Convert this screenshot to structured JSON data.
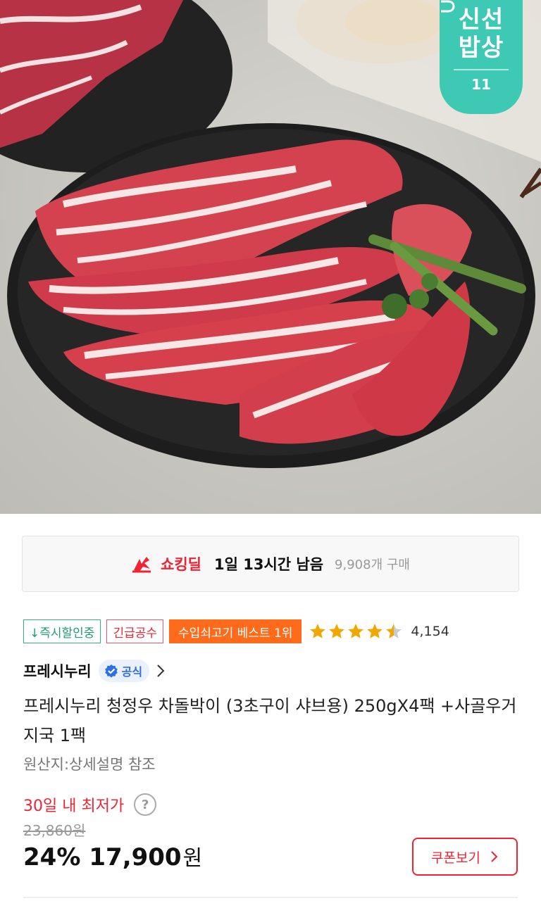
{
  "hero": {
    "badge_line1": "신선",
    "badge_line2": "밥상",
    "badge_logo": "11"
  },
  "deal": {
    "name": "쇼킹딜",
    "time_left": "1일 13시간 남음",
    "purchases": "9,908개 구매",
    "icon": "shocking-deal-flag-icon"
  },
  "tags": [
    "↓즉시할인중",
    "긴급공수",
    "수입쇠고기 베스트 1위"
  ],
  "rating": {
    "stars": 4.5,
    "count": "4,154"
  },
  "seller": {
    "name": "프레시누리",
    "official": "공식"
  },
  "product": {
    "title": "프레시누리 청정우 차돌박이 (3초구이 샤브용) 250gX4팩 +사골우거지국 1팩",
    "origin": "원산지:상세설명 참조"
  },
  "price": {
    "lowest_label": "30일 내 최저가",
    "help": "?",
    "original": "23,860원",
    "discount": "24%",
    "amount": "17,900",
    "unit": "원"
  },
  "coupon": {
    "label": "쿠폰보기"
  },
  "colors": {
    "accent": "#ee2434",
    "teal": "#3dc9b4",
    "orange": "#ff6b1a",
    "green": "#1e9d6f"
  }
}
